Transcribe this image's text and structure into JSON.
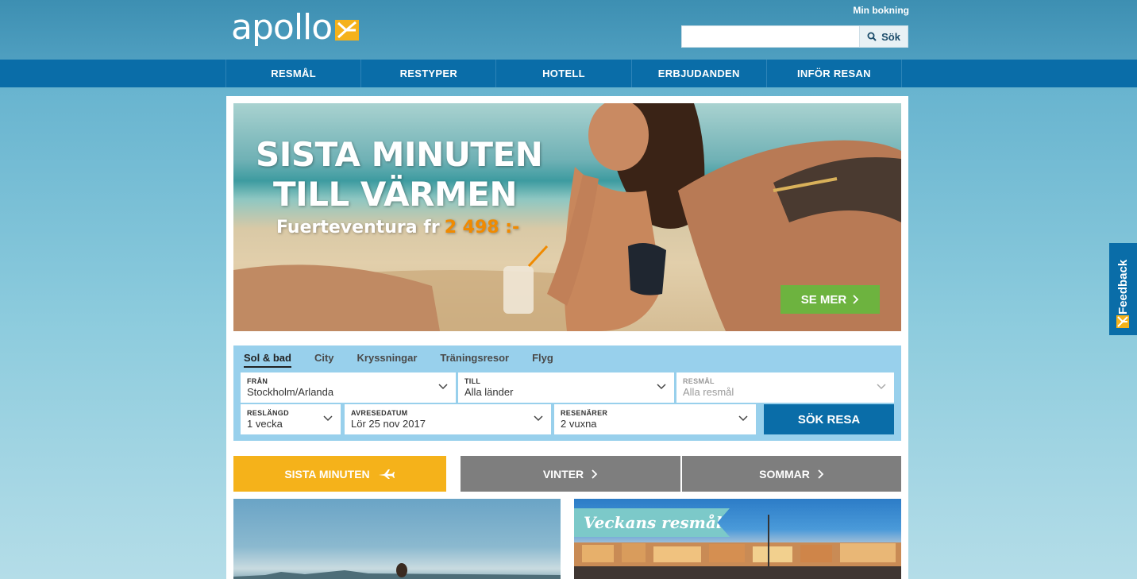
{
  "header": {
    "logo_text": "apollo",
    "my_booking": "Min bokning",
    "search": {
      "value": "",
      "button": "Sök"
    }
  },
  "nav": {
    "items": [
      "RESMÅL",
      "RESTYPER",
      "HOTELL",
      "ERBJUDANDEN",
      "INFÖR RESAN"
    ]
  },
  "hero": {
    "line1": "SISTA MINUTEN",
    "line2": "TILL VÄRMEN",
    "destination": "Fuerteventura fr",
    "price": "2 498 :-",
    "cta": "SE MER"
  },
  "booking": {
    "tabs": [
      "Sol & bad",
      "City",
      "Kryssningar",
      "Träningsresor",
      "Flyg"
    ],
    "active_tab": "Sol & bad",
    "from": {
      "label": "FRÅN",
      "value": "Stockholm/Arlanda"
    },
    "to": {
      "label": "TILL",
      "value": "Alla länder"
    },
    "destination": {
      "label": "RESMÅL",
      "value": "Alla resmål"
    },
    "duration": {
      "label": "RESLÄNGD",
      "value": "1 vecka"
    },
    "departure": {
      "label": "AVRESEDATUM",
      "value": "Lör 25 nov 2017"
    },
    "travellers": {
      "label": "RESENÄRER",
      "value": "2 vuxna"
    },
    "submit": "SÖK RESA"
  },
  "quick": {
    "sista": "SISTA MINUTEN",
    "vinter": "VINTER",
    "sommar": "SOMMAR"
  },
  "cards": {
    "right_tag": "Veckans resmål"
  },
  "feedback": {
    "label": "Feedback"
  },
  "colors": {
    "nav_blue": "#0a6da8",
    "accent_yellow": "#f5b21a",
    "cta_green": "#6db33f",
    "price_orange": "#f08a00",
    "widget_bg": "#98d0ec"
  }
}
